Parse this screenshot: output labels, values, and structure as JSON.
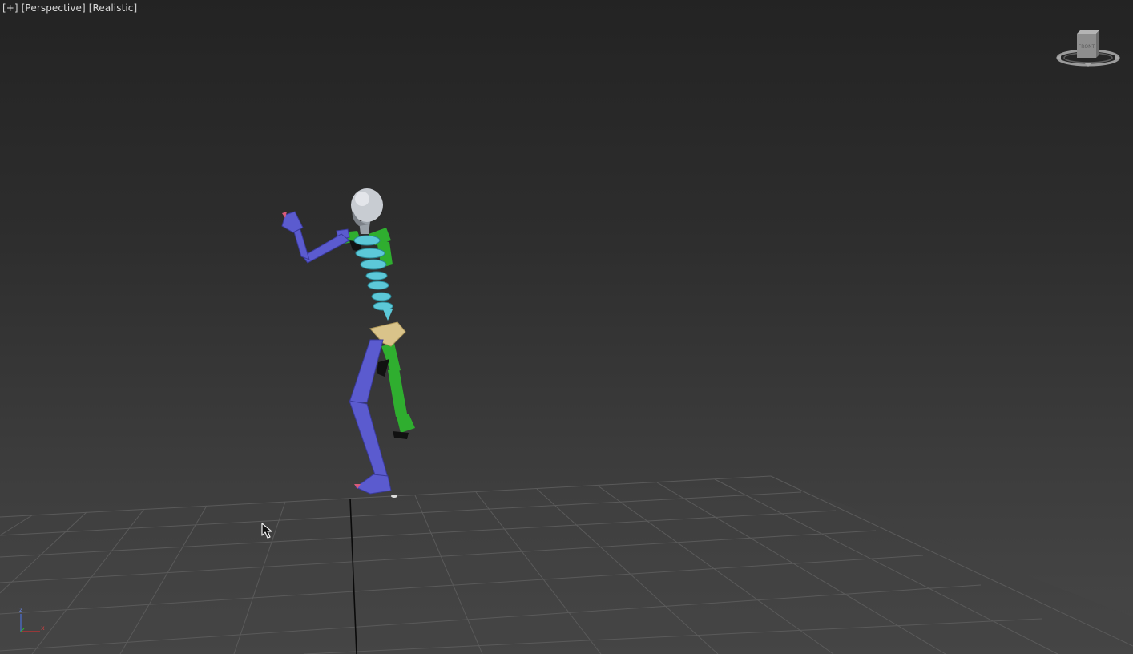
{
  "viewport": {
    "label_plus": "[+]",
    "label_view": "[Perspective]",
    "label_shading": "[Realistic]"
  },
  "viewcube": {
    "face_label": "FRONT"
  },
  "axes": {
    "z_label": "z",
    "x_label": "x"
  },
  "colors": {
    "background_top": "#232323",
    "background_bottom": "#474747",
    "grid": "#5c5c5c",
    "skeleton_left_side": "#5b5bcf",
    "skeleton_right_side": "#2fae2f",
    "spine": "#5cc8d8",
    "pelvis": "#d9c38a",
    "head": "#c8ccd2"
  }
}
